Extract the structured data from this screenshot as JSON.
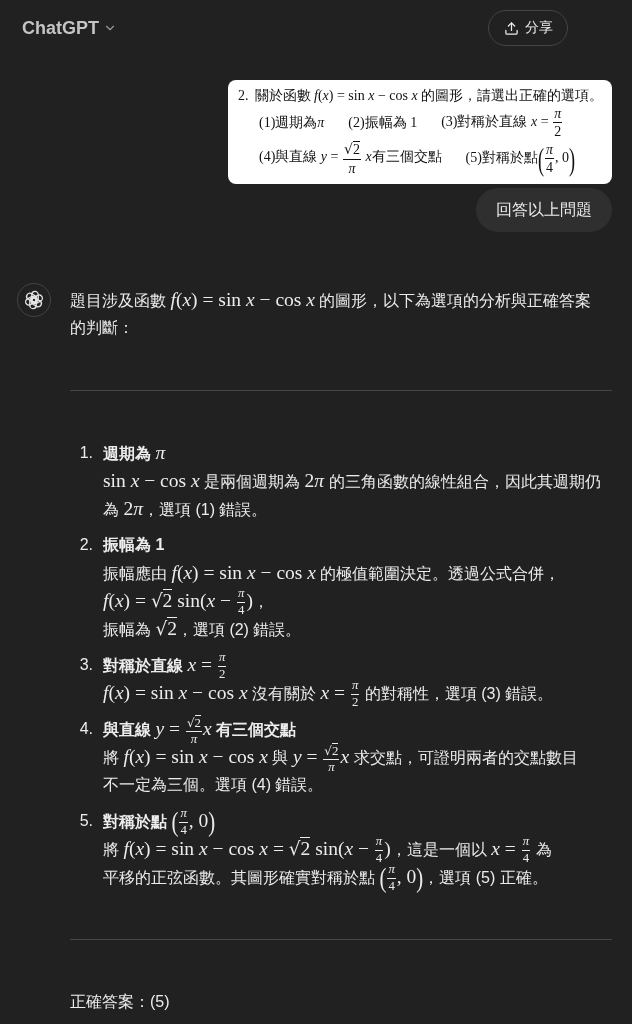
{
  "header": {
    "title": "ChatGPT",
    "share_label": "分享"
  },
  "user_message": {
    "attachment": {
      "number": "2.",
      "question": [
        {
          "kind": "text",
          "text": "關於函數 "
        },
        {
          "kind": "math",
          "text": "*f*(*x*) = sin *x* − cos *x*"
        },
        {
          "kind": "text",
          "text": " 的圖形，請選出正確的選項。"
        }
      ],
      "option_rows": [
        [
          [
            {
              "kind": "text",
              "text": "(1)週期為"
            },
            {
              "kind": "math",
              "text": "*π*"
            }
          ],
          [
            {
              "kind": "text",
              "text": "(2)振幅為 1"
            }
          ],
          [
            {
              "kind": "text",
              "text": "(3)對稱於直線 "
            },
            {
              "kind": "math",
              "text": "*x* = "
            },
            {
              "kind": "frac",
              "num": [
                {
                  "kind": "math",
                  "text": "*π*"
                }
              ],
              "den": [
                {
                  "kind": "math",
                  "text": "2"
                }
              ]
            }
          ]
        ],
        [
          [
            {
              "kind": "text",
              "text": "(4)與直線 "
            },
            {
              "kind": "math",
              "text": "*y* = "
            },
            {
              "kind": "frac",
              "num": [
                {
                  "kind": "sqrt",
                  "sign": "√",
                  "body": [
                    {
                      "kind": "math",
                      "text": "2"
                    }
                  ]
                }
              ],
              "den": [
                {
                  "kind": "math",
                  "text": "*π*"
                }
              ]
            },
            {
              "kind": "math",
              "text": " *x*"
            },
            {
              "kind": "text",
              "text": "有三個交點"
            }
          ],
          [
            {
              "kind": "text",
              "text": "(5)對稱於點"
            },
            {
              "kind": "delim",
              "text": "("
            },
            {
              "kind": "frac",
              "num": [
                {
                  "kind": "math",
                  "text": "*π*"
                }
              ],
              "den": [
                {
                  "kind": "math",
                  "text": "4"
                }
              ]
            },
            {
              "kind": "math",
              "text": ", 0"
            },
            {
              "kind": "delim",
              "text": ")"
            }
          ]
        ]
      ]
    },
    "text": "回答以上問題"
  },
  "assistant_message": {
    "intro_lines": [
      [
        {
          "kind": "text",
          "text": "題目涉及函數 "
        },
        {
          "kind": "math",
          "text": "*f*(*x*) = sin *x* − cos *x*"
        },
        {
          "kind": "text",
          "text": " 的圖形，以下為選項的分析與正確答案"
        }
      ],
      [
        {
          "kind": "text",
          "text": "的判斷："
        }
      ]
    ],
    "items": [
      {
        "number": "1.",
        "title": [
          {
            "kind": "text",
            "text": "週期為 "
          },
          {
            "kind": "math",
            "text": "*π*"
          }
        ],
        "lines": [
          [
            {
              "kind": "math",
              "text": "sin *x* − cos *x*"
            },
            {
              "kind": "text",
              "text": " 是兩個週期為 "
            },
            {
              "kind": "math",
              "text": "2"
            },
            {
              "kind": "math",
              "text": "*π*"
            },
            {
              "kind": "text",
              "text": " 的三角函數的線性組合，因此其週期仍"
            }
          ],
          [
            {
              "kind": "text",
              "text": "為 "
            },
            {
              "kind": "math",
              "text": "2"
            },
            {
              "kind": "math",
              "text": "*π*"
            },
            {
              "kind": "text",
              "text": "，選項 (1) 錯誤。"
            }
          ]
        ]
      },
      {
        "number": "2.",
        "title": [
          {
            "kind": "text",
            "text": "振幅為 1"
          }
        ],
        "lines": [
          [
            {
              "kind": "text",
              "text": "振幅應由 "
            },
            {
              "kind": "math",
              "text": "*f*(*x*) = sin *x* − cos *x*"
            },
            {
              "kind": "text",
              "text": " 的極值範圍決定。透過公式合併，"
            }
          ],
          [
            {
              "kind": "math",
              "text": "*f*(*x*) = "
            },
            {
              "kind": "sqrt",
              "sign": "√",
              "body": [
                {
                  "kind": "math",
                  "text": "2"
                }
              ]
            },
            {
              "kind": "math",
              "text": " sin(*x* − "
            },
            {
              "kind": "frac",
              "num": [
                {
                  "kind": "math",
                  "text": "*π*"
                }
              ],
              "den": [
                {
                  "kind": "math",
                  "text": "4"
                }
              ]
            },
            {
              "kind": "math",
              "text": ")"
            },
            {
              "kind": "text",
              "text": "，"
            }
          ],
          [
            {
              "kind": "text",
              "text": "振幅為 "
            },
            {
              "kind": "sqrt",
              "sign": "√",
              "body": [
                {
                  "kind": "math",
                  "text": "2"
                }
              ]
            },
            {
              "kind": "text",
              "text": "，選項 (2) 錯誤。"
            }
          ]
        ]
      },
      {
        "number": "3.",
        "title": [
          {
            "kind": "text",
            "text": "對稱於直線 "
          },
          {
            "kind": "math",
            "text": "*x* = "
          },
          {
            "kind": "frac",
            "num": [
              {
                "kind": "math",
                "text": "*π*"
              }
            ],
            "den": [
              {
                "kind": "math",
                "text": "2"
              }
            ]
          }
        ],
        "lines": [
          [
            {
              "kind": "math",
              "text": "*f*(*x*) = sin *x* − cos *x*"
            },
            {
              "kind": "text",
              "text": " 沒有關於 "
            },
            {
              "kind": "math",
              "text": "*x* = "
            },
            {
              "kind": "frac",
              "num": [
                {
                  "kind": "math",
                  "text": "*π*"
                }
              ],
              "den": [
                {
                  "kind": "math",
                  "text": "2"
                }
              ]
            },
            {
              "kind": "text",
              "text": " 的對稱性，選項 (3) 錯誤。"
            }
          ]
        ]
      },
      {
        "number": "4.",
        "title": [
          {
            "kind": "text",
            "text": "與直線 "
          },
          {
            "kind": "math",
            "text": "*y* = "
          },
          {
            "kind": "frac",
            "num": [
              {
                "kind": "sqrt",
                "sign": "√",
                "body": [
                  {
                    "kind": "math",
                    "text": "2"
                  }
                ]
              }
            ],
            "den": [
              {
                "kind": "math",
                "text": "*π*"
              }
            ]
          },
          {
            "kind": "math",
            "text": "*x*"
          },
          {
            "kind": "text",
            "text": " 有三個交點"
          }
        ],
        "lines": [
          [
            {
              "kind": "text",
              "text": "將 "
            },
            {
              "kind": "math",
              "text": "*f*(*x*) = sin *x* − cos *x*"
            },
            {
              "kind": "text",
              "text": " 與 "
            },
            {
              "kind": "math",
              "text": "*y* = "
            },
            {
              "kind": "frac",
              "num": [
                {
                  "kind": "sqrt",
                  "sign": "√",
                  "body": [
                    {
                      "kind": "math",
                      "text": "2"
                    }
                  ]
                }
              ],
              "den": [
                {
                  "kind": "math",
                  "text": "*π*"
                }
              ]
            },
            {
              "kind": "math",
              "text": "*x*"
            },
            {
              "kind": "text",
              "text": " 求交點，可證明兩者的交點數目"
            }
          ],
          [
            {
              "kind": "text",
              "text": "不一定為三個。選項 (4) 錯誤。"
            }
          ]
        ]
      },
      {
        "number": "5.",
        "title": [
          {
            "kind": "text",
            "text": "對稱於點 "
          },
          {
            "kind": "delim",
            "text": "("
          },
          {
            "kind": "frac",
            "num": [
              {
                "kind": "math",
                "text": "*π*"
              }
            ],
            "den": [
              {
                "kind": "math",
                "text": "4"
              }
            ]
          },
          {
            "kind": "math",
            "text": ", 0"
          },
          {
            "kind": "delim",
            "text": ")"
          }
        ],
        "lines": [
          [
            {
              "kind": "text",
              "text": "將 "
            },
            {
              "kind": "math",
              "text": "*f*(*x*) = sin *x* − cos *x* = "
            },
            {
              "kind": "sqrt",
              "sign": "√",
              "body": [
                {
                  "kind": "math",
                  "text": "2"
                }
              ]
            },
            {
              "kind": "math",
              "text": " sin(*x* − "
            },
            {
              "kind": "frac",
              "num": [
                {
                  "kind": "math",
                  "text": "*π*"
                }
              ],
              "den": [
                {
                  "kind": "math",
                  "text": "4"
                }
              ]
            },
            {
              "kind": "math",
              "text": ")"
            },
            {
              "kind": "text",
              "text": "，這是一個以 "
            },
            {
              "kind": "math",
              "text": "*x* = "
            },
            {
              "kind": "frac",
              "num": [
                {
                  "kind": "math",
                  "text": "*π*"
                }
              ],
              "den": [
                {
                  "kind": "math",
                  "text": "4"
                }
              ]
            },
            {
              "kind": "text",
              "text": " 為"
            }
          ],
          [
            {
              "kind": "text",
              "text": "平移的正弦函數。其圖形確實對稱於點 "
            },
            {
              "kind": "delim",
              "text": "("
            },
            {
              "kind": "frac",
              "num": [
                {
                  "kind": "math",
                  "text": "*π*"
                }
              ],
              "den": [
                {
                  "kind": "math",
                  "text": "4"
                }
              ]
            },
            {
              "kind": "math",
              "text": ", 0"
            },
            {
              "kind": "delim",
              "text": ")"
            },
            {
              "kind": "text",
              "text": "，選項 (5) 正確。"
            }
          ]
        ]
      }
    ],
    "answer": "正確答案：(5)"
  }
}
